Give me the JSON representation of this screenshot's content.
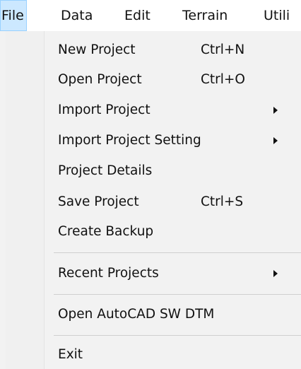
{
  "menubar": {
    "items": [
      {
        "label": "File"
      },
      {
        "label": "Data"
      },
      {
        "label": "Edit"
      },
      {
        "label": "Terrain"
      },
      {
        "label": "Utili"
      }
    ]
  },
  "file_menu": {
    "items": [
      {
        "label": "New Project",
        "shortcut": "Ctrl+N"
      },
      {
        "label": "Open Project",
        "shortcut": "Ctrl+O"
      },
      {
        "label": "Import Project"
      },
      {
        "label": "Import Project Setting"
      },
      {
        "label": "Project Details"
      },
      {
        "label": "Save Project",
        "shortcut": "Ctrl+S"
      },
      {
        "label": "Create Backup"
      },
      {
        "label": "Recent Projects"
      },
      {
        "label": "Open AutoCAD SW DTM"
      },
      {
        "label": "Exit"
      }
    ],
    "icons": {
      "submenu": "chevron-right-icon"
    }
  }
}
